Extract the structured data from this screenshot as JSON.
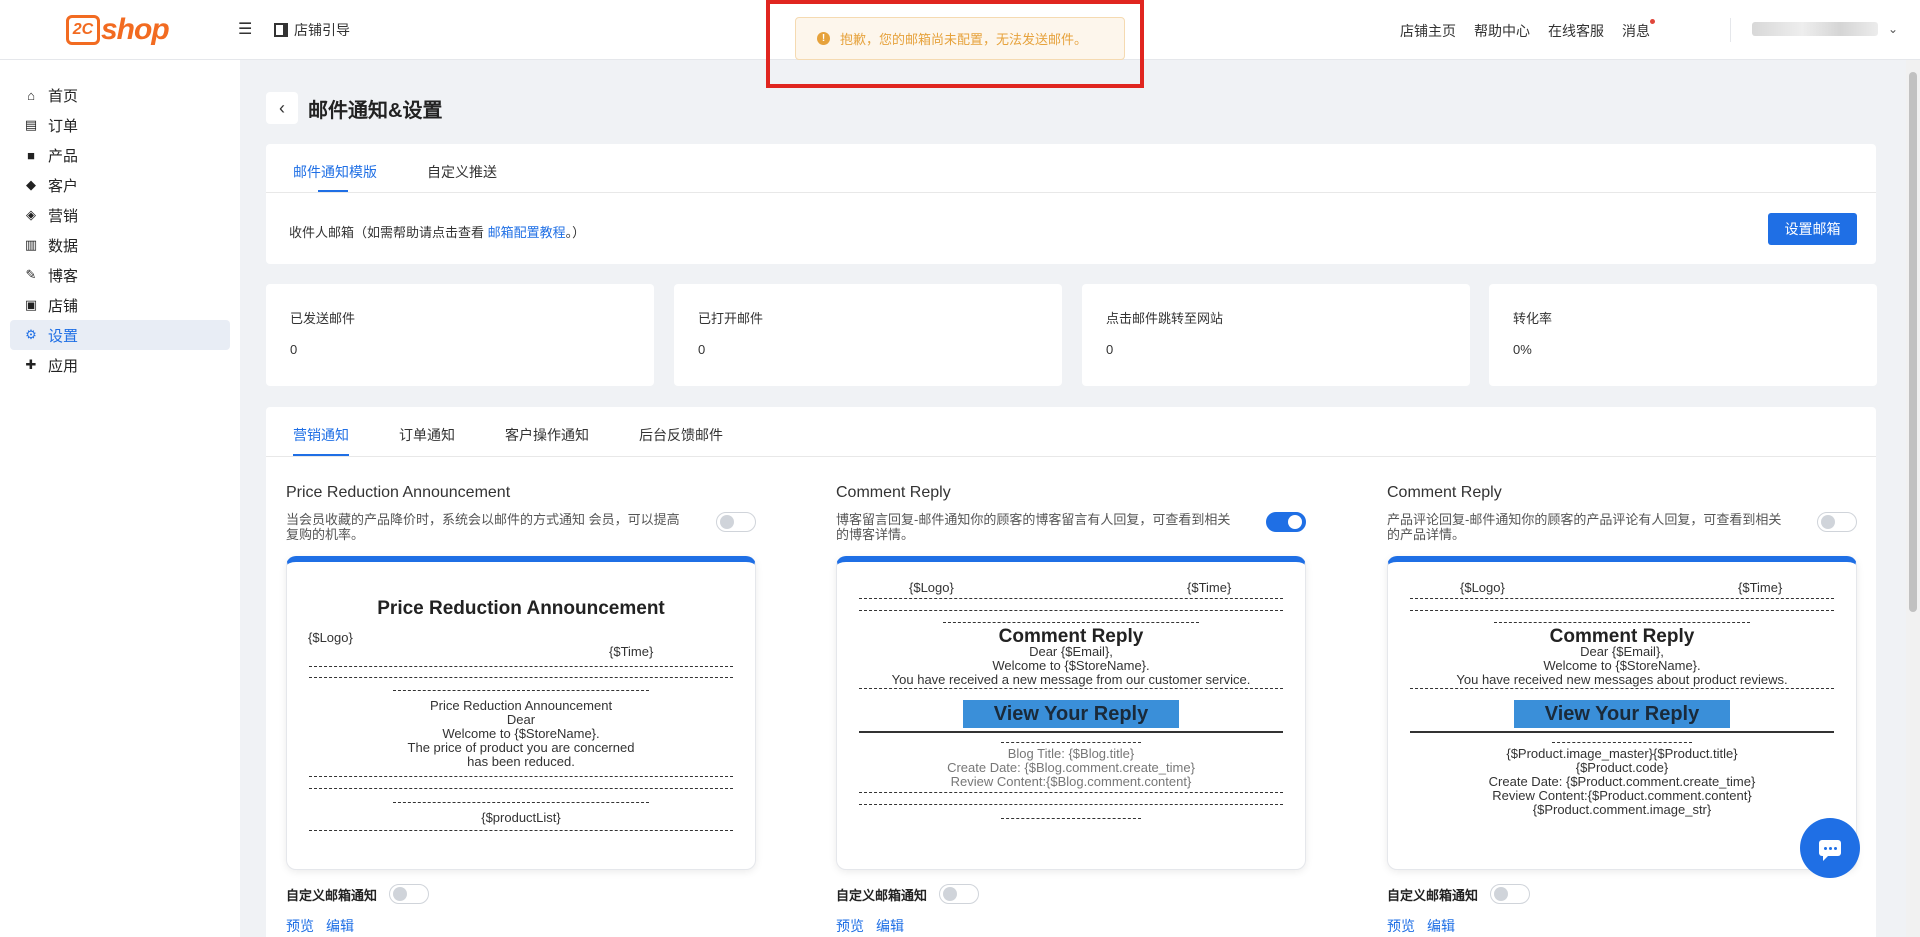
{
  "brand": {
    "logo_mark": "2C",
    "logo_word": "shop",
    "color": "#f26b21"
  },
  "header": {
    "store_guide": "店铺引导",
    "nav": [
      "店铺主页",
      "帮助中心",
      "在线客服",
      "消息"
    ]
  },
  "alert": {
    "message": "抱歉，您的邮箱尚未配置，无法发送邮件。"
  },
  "sidebar": {
    "items": [
      {
        "label": "首页",
        "icon": "home-icon"
      },
      {
        "label": "订单",
        "icon": "clipboard-icon"
      },
      {
        "label": "产品",
        "icon": "bag-icon"
      },
      {
        "label": "客户",
        "icon": "diamond-icon"
      },
      {
        "label": "营销",
        "icon": "tag-icon"
      },
      {
        "label": "数据",
        "icon": "bar-chart-icon"
      },
      {
        "label": "博客",
        "icon": "edit-icon"
      },
      {
        "label": "店铺",
        "icon": "store-icon"
      },
      {
        "label": "设置",
        "icon": "gear-icon",
        "active": true
      },
      {
        "label": "应用",
        "icon": "puzzle-icon"
      }
    ]
  },
  "page": {
    "title": "邮件通知&设置",
    "top_tabs": [
      "邮件通知模版",
      "自定义推送"
    ],
    "recipient_prefix": "收件人邮箱（如需帮助请点击查看 ",
    "recipient_link": "邮箱配置教程",
    "recipient_suffix": "。）",
    "setup_button": "设置邮箱"
  },
  "stats": [
    {
      "label": "已发送邮件",
      "value": "0"
    },
    {
      "label": "已打开邮件",
      "value": "0"
    },
    {
      "label": "点击邮件跳转至网站",
      "value": "0"
    },
    {
      "label": "转化率",
      "value": "0%"
    }
  ],
  "notify_tabs": [
    "营销通知",
    "订单通知",
    "客户操作通知",
    "后台反馈邮件"
  ],
  "templates": [
    {
      "title": "Price Reduction Announcement",
      "desc": "当会员收藏的产品降价时，系统会以邮件的方式通知 会员，可以提高复购的机率。",
      "enabled": false,
      "preview": {
        "heading": "Price Reduction Announcement",
        "logo": "{$Logo}",
        "time": "{$Time}",
        "line1": "Price Reduction Announcement",
        "line2": "Dear",
        "line3": "Welcome to {$StoreName}.",
        "line4": "The price of product you are concerned",
        "line5": "has been reduced.",
        "list": "{$productList}"
      },
      "custom_label": "自定义邮箱通知",
      "custom_enabled": false,
      "preview_link": "预览",
      "edit_link": "编辑"
    },
    {
      "title": "Comment Reply",
      "desc": "博客留言回复-邮件通知你的顾客的博客留言有人回复，可查看到相关的博客详情。",
      "enabled": true,
      "preview": {
        "logo": "{$Logo}",
        "time": "{$Time}",
        "heading": "Comment Reply",
        "line1": "Dear {$Email},",
        "line2": "Welcome to {$StoreName}.",
        "line3": "You have received a new message from our customer service.",
        "button": "View Your Reply",
        "d1": "Blog Title: {$Blog.title}",
        "d2": "Create Date: {$Blog.comment.create_time}",
        "d3": "Review Content:{$Blog.comment.content}"
      },
      "custom_label": "自定义邮箱通知",
      "custom_enabled": false,
      "preview_link": "预览",
      "edit_link": "编辑"
    },
    {
      "title": "Comment Reply",
      "desc": "产品评论回复-邮件通知你的顾客的产品评论有人回复，可查看到相关的产品详情。",
      "enabled": false,
      "preview": {
        "logo": "{$Logo}",
        "time": "{$Time}",
        "heading": "Comment Reply",
        "line1": "Dear {$Email},",
        "line2": "Welcome to {$StoreName}.",
        "line3": "You have received new messages about product reviews.",
        "button": "View Your Reply",
        "d1": "{$Product.image_master}{$Product.title}",
        "d2": "{$Product.code}",
        "d3": "Create Date: {$Product.comment.create_time}",
        "d4": "Review Content:{$Product.comment.content}",
        "d5": "{$Product.comment.image_str}"
      },
      "custom_label": "自定义邮箱通知",
      "custom_enabled": false,
      "preview_link": "预览",
      "edit_link": "编辑"
    }
  ],
  "colors": {
    "primary": "#1f6fe5",
    "alert_text": "#e6a23c",
    "alert_frame": "#e0251f"
  }
}
